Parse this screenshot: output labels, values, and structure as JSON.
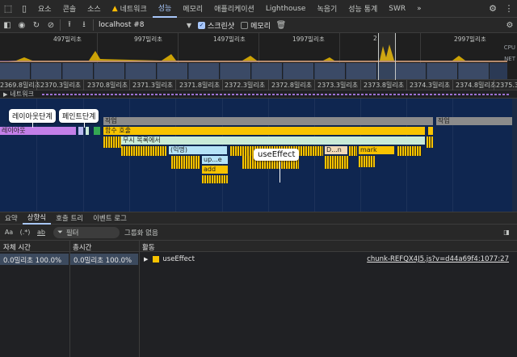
{
  "tabs": {
    "items": [
      "요소",
      "콘솔",
      "소스",
      "네트워크",
      "성능",
      "메모리",
      "애플리케이션",
      "Lighthouse",
      "녹음기",
      "성능 통계",
      "SWR"
    ],
    "active": "성능",
    "more": "»"
  },
  "toolbar": {
    "target": "localhost #8",
    "screenshot_label": "스크린샷",
    "memory_label": "메모리",
    "screenshot_checked": true,
    "memory_checked": false
  },
  "overview": {
    "ticks": [
      "497밀리초",
      "997밀리초",
      "1497밀리초",
      "1997밀리초",
      "2",
      "2997밀리초"
    ],
    "cpu_label": "CPU",
    "net_label": "NET"
  },
  "ruler": {
    "ticks": [
      "2369.8밀리초",
      "2370.3밀리초",
      "2370.8밀리초",
      "2371.3밀리초",
      "2371.8밀리초",
      "2372.3밀리초",
      "2372.8밀리초",
      "2373.3밀리초",
      "2373.8밀리초",
      "2374.3밀리초",
      "2374.8밀리초",
      "2375.3밀"
    ]
  },
  "network_track": "네트워크",
  "flame": {
    "task_label": "작업",
    "task2_label": "작업",
    "layout_label": "레이아웃",
    "function_call": "함수 호출",
    "anonymous_list": "무시 목록에서",
    "anon": "(익명)",
    "up": "up...e",
    "add": "add",
    "dn": "D...n",
    "mark": "mark",
    "callout_layout": "레이아웃단계",
    "callout_paint": "페인트단계",
    "callout_effect": "useEffect"
  },
  "bottom_tabs": {
    "items": [
      "요약",
      "상향식",
      "호출 트리",
      "이벤트 로그"
    ],
    "active": "상향식"
  },
  "filter": {
    "aa": "Aa",
    "dotstar": "(.*)",
    "ab": "ab",
    "placeholder": "필터",
    "group": "그룹화 없음"
  },
  "table": {
    "headers": {
      "self": "자체 시간",
      "total": "총시간",
      "activity": "활동"
    },
    "row": {
      "self": "0.0밀리초 100.0%",
      "total": "0.0밀리초 100.0%",
      "activity": "useEffect",
      "source": "chunk-REFQX4J5.js?v=d44a69f4:1077:27"
    }
  }
}
